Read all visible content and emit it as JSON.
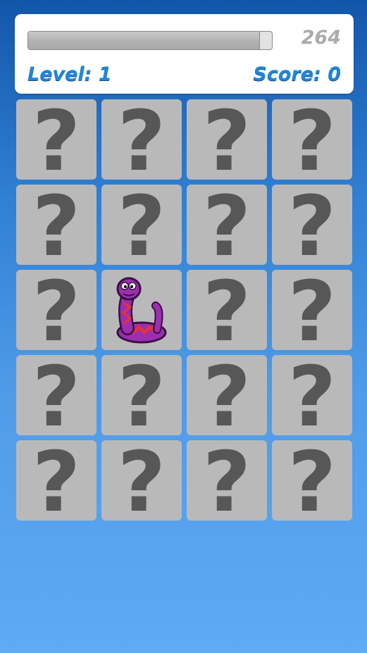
{
  "hud": {
    "timer_value": "264",
    "timer_fraction": 0.95,
    "level_label": "Level: 1",
    "score_label": "Score: 0"
  },
  "board": {
    "rows": 5,
    "cols": 4,
    "hidden_symbol": "?",
    "cards": [
      {
        "state": "hidden"
      },
      {
        "state": "hidden"
      },
      {
        "state": "hidden"
      },
      {
        "state": "hidden"
      },
      {
        "state": "hidden"
      },
      {
        "state": "hidden"
      },
      {
        "state": "hidden"
      },
      {
        "state": "hidden"
      },
      {
        "state": "hidden"
      },
      {
        "state": "revealed",
        "icon": "snake-icon"
      },
      {
        "state": "hidden"
      },
      {
        "state": "hidden"
      },
      {
        "state": "hidden"
      },
      {
        "state": "hidden"
      },
      {
        "state": "hidden"
      },
      {
        "state": "hidden"
      },
      {
        "state": "hidden"
      },
      {
        "state": "hidden"
      },
      {
        "state": "hidden"
      },
      {
        "state": "hidden"
      }
    ]
  },
  "colors": {
    "accent": "#1f86d9",
    "card_back": "#b9b9b9",
    "question_mark": "#575757",
    "snake_body": "#9b2fb0",
    "snake_pattern": "#e8352b"
  }
}
